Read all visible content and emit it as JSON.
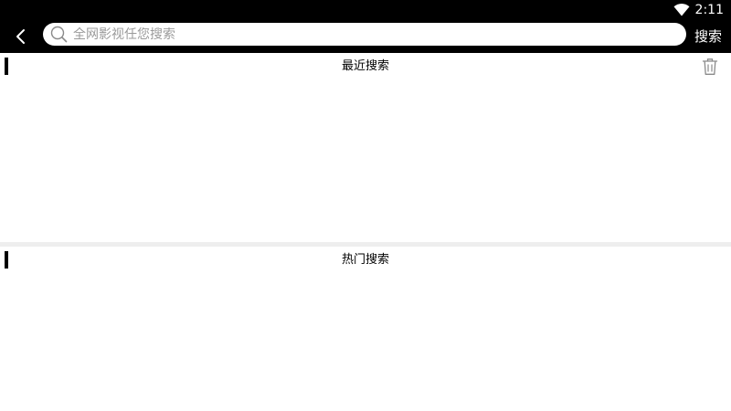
{
  "status_bar": {
    "time": "2:11",
    "wifi_icon": "wifi-icon"
  },
  "header": {
    "back_icon": "chevron-left-icon",
    "search": {
      "value": "",
      "placeholder": "全网影视任您搜索",
      "icon": "search-icon"
    },
    "search_button_label": "搜索"
  },
  "sections": {
    "recent": {
      "title": "最近搜索",
      "delete_icon": "trash-icon",
      "items": []
    },
    "hot": {
      "title": "热门搜索",
      "items": []
    }
  },
  "colors": {
    "header_bg": "#000000",
    "accent_marker": "#000000",
    "divider": "#eeeeee",
    "placeholder": "#9a9a9a",
    "icon_gray": "#8a8a8a"
  }
}
